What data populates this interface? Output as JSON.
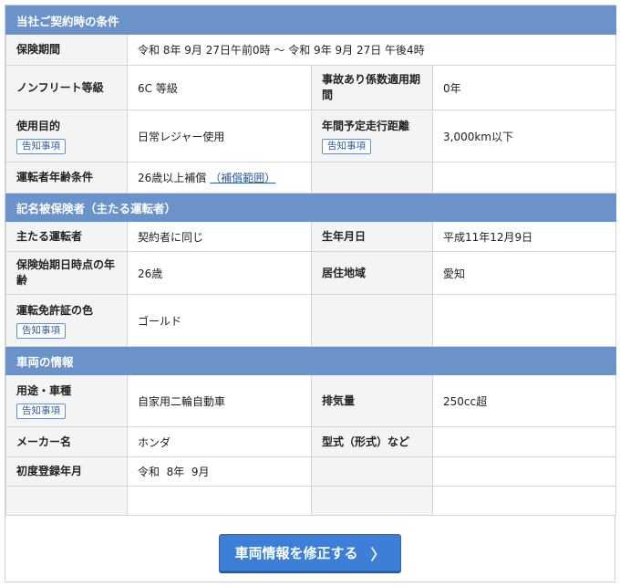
{
  "contract": {
    "header": "当社ご契約時の条件",
    "period_label": "保険期間",
    "period_value": "令和 8年 9月 27日午前0時 〜 令和 9年 9月 27日 午後4時",
    "nonfleet_label": "ノンフリート等級",
    "nonfleet_value": "6C 等級",
    "accident_coef_label": "事故あり係数適用期間",
    "accident_coef_value": "0年",
    "usage_label": "使用目的",
    "usage_value": "日常レジャー使用",
    "mileage_label": "年間予定走行距離",
    "mileage_value": "3,000km以下",
    "age_label": "運転者年齢条件",
    "age_value": "26歳以上補償",
    "age_link": "（補償範囲）"
  },
  "insured": {
    "header": "記名被保険者（主たる運転者）",
    "driver_label": "主たる運転者",
    "driver_value": "契約者に同じ",
    "birth_label": "生年月日",
    "birth_value": "平成11年12月9日",
    "age_at_start_label": "保険始期日時点の年齢",
    "age_at_start_value": "26歳",
    "region_label": "居住地域",
    "region_value": "愛知",
    "license_label": "運転免許証の色",
    "license_value": "ゴールド"
  },
  "vehicle": {
    "header": "車両の情報",
    "type_label": "用途・車種",
    "type_value": "自家用二輪自動車",
    "displacement_label": "排気量",
    "displacement_value": "250cc超",
    "maker_label": "メーカー名",
    "maker_value": "ホンダ",
    "model_label": "型式（形式）など",
    "model_value": "",
    "first_reg_label": "初度登録年月",
    "first_reg_value": "令和  8年  9月"
  },
  "notice_tag": "告知事項",
  "edit_button": {
    "label": "車両情報を修正する",
    "icon": "chevron-right-icon",
    "glyph": "〉"
  },
  "colors": {
    "section_header": "#6b93c9",
    "button": "#3d7fd6",
    "tag_border": "#6d8fbf"
  }
}
